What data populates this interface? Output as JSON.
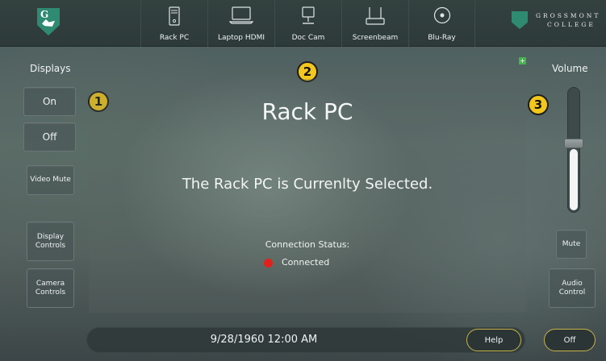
{
  "header": {
    "tabs": [
      {
        "label": "Rack PC",
        "icon": "pc-tower-icon"
      },
      {
        "label": "Laptop HDMI",
        "icon": "laptop-icon"
      },
      {
        "label": "Doc Cam",
        "icon": "document-camera-icon"
      },
      {
        "label": "Screenbeam",
        "icon": "wireless-receiver-icon"
      },
      {
        "label": "Blu-Ray",
        "icon": "disc-icon"
      }
    ],
    "college_line1": "GROSSMONT",
    "college_line2": "COLLEGE"
  },
  "left": {
    "section_label": "Displays",
    "on_label": "On",
    "off_label": "Off",
    "video_mute_label": "Video Mute",
    "display_controls_label": "Display Controls",
    "camera_controls_label": "Camera Controls"
  },
  "main": {
    "source_title": "Rack PC",
    "selected_message": "The Rack PC is Currenlty Selected.",
    "connection_label": "Connection Status:",
    "connection_value": "Connected",
    "connection_color": "#e3211c"
  },
  "right": {
    "section_label": "Volume",
    "volume_level": 0.5,
    "mute_label": "Mute",
    "audio_control_label": "Audio Control",
    "off_label": "Off"
  },
  "footer": {
    "datetime": "9/28/1960 12:00 AM",
    "help_label": "Help"
  },
  "badges": [
    "1",
    "2",
    "3"
  ],
  "colors": {
    "badge": "#f3c71b",
    "brand_green": "#2f8a72",
    "pill_border": "#c8b24a"
  }
}
